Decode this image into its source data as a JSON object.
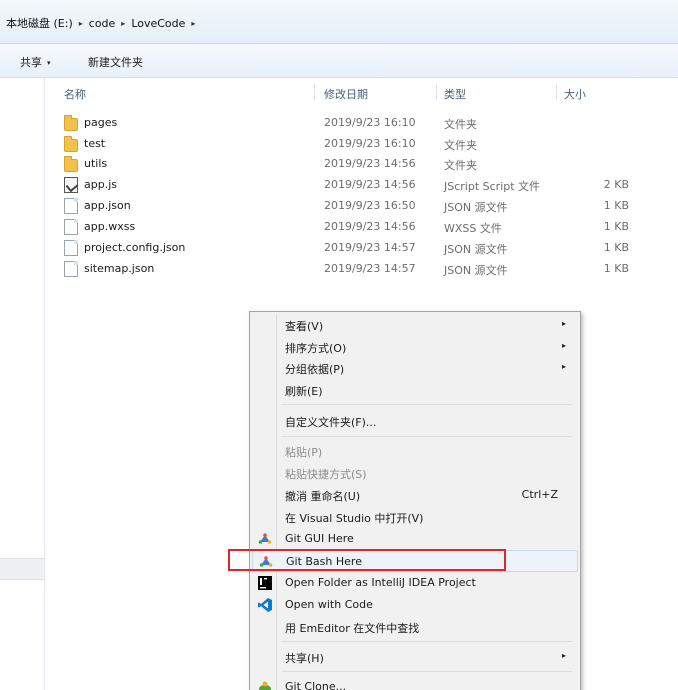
{
  "breadcrumb": {
    "items": [
      "本地磁盘 (E:)",
      "code",
      "LoveCode"
    ],
    "separator": "▸"
  },
  "toolbar": {
    "share_label": "共享",
    "share_caret": "▾",
    "new_folder_label": "新建文件夹"
  },
  "columns": {
    "name": "名称",
    "date": "修改日期",
    "type": "类型",
    "size": "大小"
  },
  "files": [
    {
      "name": "pages",
      "date": "2019/9/23 16:10",
      "type": "文件夹",
      "size": "",
      "icon": "folder-icon"
    },
    {
      "name": "test",
      "date": "2019/9/23 16:10",
      "type": "文件夹",
      "size": "",
      "icon": "folder-icon"
    },
    {
      "name": "utils",
      "date": "2019/9/23 14:56",
      "type": "文件夹",
      "size": "",
      "icon": "folder-icon"
    },
    {
      "name": "app.js",
      "date": "2019/9/23 14:56",
      "type": "JScript Script 文件",
      "size": "2 KB",
      "icon": "jscript-file-icon"
    },
    {
      "name": "app.json",
      "date": "2019/9/23 16:50",
      "type": "JSON 源文件",
      "size": "1 KB",
      "icon": "file-icon"
    },
    {
      "name": "app.wxss",
      "date": "2019/9/23 14:56",
      "type": "WXSS 文件",
      "size": "1 KB",
      "icon": "file-icon"
    },
    {
      "name": "project.config.json",
      "date": "2019/9/23 14:57",
      "type": "JSON 源文件",
      "size": "1 KB",
      "icon": "file-icon"
    },
    {
      "name": "sitemap.json",
      "date": "2019/9/23 14:57",
      "type": "JSON 源文件",
      "size": "1 KB",
      "icon": "file-icon"
    }
  ],
  "context_menu": {
    "submenu_arrow": "▸",
    "items": [
      {
        "label": "查看(V)"
      },
      {
        "label": "排序方式(O)"
      },
      {
        "label": "分组依据(P)"
      },
      {
        "label": "刷新(E)"
      },
      {
        "label": "自定义文件夹(F)..."
      },
      {
        "label": "粘贴(P)"
      },
      {
        "label": "粘贴快捷方式(S)"
      },
      {
        "label": "撤消 重命名(U)",
        "shortcut": "Ctrl+Z"
      },
      {
        "label": "在 Visual Studio 中打开(V)"
      },
      {
        "label": "Git GUI Here",
        "icon": "git-gui-icon"
      },
      {
        "label": "Git Bash Here",
        "icon": "git-bash-icon",
        "highlighted": true
      },
      {
        "label": "Open Folder as IntelliJ IDEA Project",
        "icon": "intellij-icon"
      },
      {
        "label": "Open with Code",
        "icon": "vscode-icon"
      },
      {
        "label": "用 EmEditor 在文件中查找",
        "icon": "emeditor-icon"
      },
      {
        "label": "共享(H)"
      },
      {
        "label": "Git Clone...",
        "icon": "tortoisegit-icon"
      }
    ]
  },
  "colors": {
    "highlight_box": "#e0262a",
    "folder": "#f2c24d",
    "vscode": "#0e7acb",
    "git": "#f05033"
  }
}
